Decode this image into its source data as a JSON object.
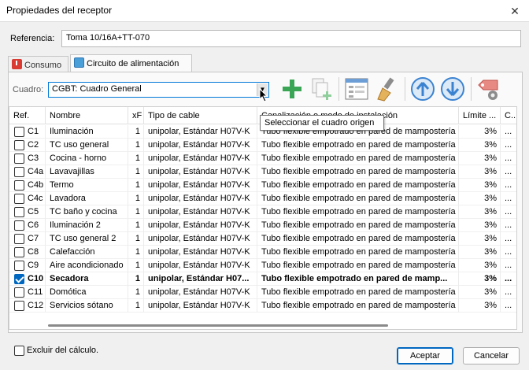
{
  "window": {
    "title": "Propiedades del receptor",
    "close_glyph": "✕"
  },
  "referencia": {
    "label": "Referencia:",
    "value": "Toma 10/16A+TT-070"
  },
  "tabs": [
    {
      "label": "Consumo",
      "icon": "power-icon",
      "active": false
    },
    {
      "label": "Circuito de alimentación",
      "icon": "shield-icon",
      "active": true
    }
  ],
  "cuadro": {
    "label": "Cuadro:",
    "value": "CGBT: Cuadro General"
  },
  "toolbar": {
    "buttons": [
      "add-icon",
      "copy-add-icon",
      "form-icon",
      "brush-icon",
      "arrow-up-icon",
      "arrow-down-icon",
      "tag-settings-icon"
    ]
  },
  "tooltip": {
    "text": "Seleccionar el cuadro origen"
  },
  "table": {
    "headers": {
      "ref": "Ref.",
      "nombre": "Nombre",
      "xf": "xF",
      "tipo": "Tipo de cable",
      "canal": "Canalización o modo de instalación",
      "limite": "Límite ...",
      "last": "C..."
    },
    "rows": [
      {
        "checked": false,
        "ref": "C1",
        "nombre": "Iluminación",
        "xf": "1",
        "tipo": "unipolar, Estándar H07V-K",
        "canal": "Tubo flexible empotrado en pared de mampostería",
        "limite": "3%",
        "last": "..."
      },
      {
        "checked": false,
        "ref": "C2",
        "nombre": "TC uso general",
        "xf": "1",
        "tipo": "unipolar, Estándar H07V-K",
        "canal": "Tubo flexible empotrado en pared de mampostería",
        "limite": "3%",
        "last": "..."
      },
      {
        "checked": false,
        "ref": "C3",
        "nombre": "Cocina - horno",
        "xf": "1",
        "tipo": "unipolar, Estándar H07V-K",
        "canal": "Tubo flexible empotrado en pared de mampostería",
        "limite": "3%",
        "last": "..."
      },
      {
        "checked": false,
        "ref": "C4a",
        "nombre": "Lavavajillas",
        "xf": "1",
        "tipo": "unipolar, Estándar H07V-K",
        "canal": "Tubo flexible empotrado en pared de mampostería",
        "limite": "3%",
        "last": "..."
      },
      {
        "checked": false,
        "ref": "C4b",
        "nombre": "Termo",
        "xf": "1",
        "tipo": "unipolar, Estándar H07V-K",
        "canal": "Tubo flexible empotrado en pared de mampostería",
        "limite": "3%",
        "last": "..."
      },
      {
        "checked": false,
        "ref": "C4c",
        "nombre": "Lavadora",
        "xf": "1",
        "tipo": "unipolar, Estándar H07V-K",
        "canal": "Tubo flexible empotrado en pared de mampostería",
        "limite": "3%",
        "last": "..."
      },
      {
        "checked": false,
        "ref": "C5",
        "nombre": "TC baño y cocina",
        "xf": "1",
        "tipo": "unipolar, Estándar H07V-K",
        "canal": "Tubo flexible empotrado en pared de mampostería",
        "limite": "3%",
        "last": "..."
      },
      {
        "checked": false,
        "ref": "C6",
        "nombre": "Iluminación 2",
        "xf": "1",
        "tipo": "unipolar, Estándar H07V-K",
        "canal": "Tubo flexible empotrado en pared de mampostería",
        "limite": "3%",
        "last": "..."
      },
      {
        "checked": false,
        "ref": "C7",
        "nombre": "TC uso general 2",
        "xf": "1",
        "tipo": "unipolar, Estándar H07V-K",
        "canal": "Tubo flexible empotrado en pared de mampostería",
        "limite": "3%",
        "last": "..."
      },
      {
        "checked": false,
        "ref": "C8",
        "nombre": "Calefacción",
        "xf": "1",
        "tipo": "unipolar, Estándar H07V-K",
        "canal": "Tubo flexible empotrado en pared de mampostería",
        "limite": "3%",
        "last": "..."
      },
      {
        "checked": false,
        "ref": "C9",
        "nombre": "Aire acondicionado",
        "xf": "1",
        "tipo": "unipolar, Estándar H07V-K",
        "canal": "Tubo flexible empotrado en pared de mampostería",
        "limite": "3%",
        "last": "..."
      },
      {
        "checked": true,
        "ref": "C10",
        "nombre": "Secadora",
        "xf": "1",
        "tipo": "unipolar, Estándar H07...",
        "canal": "Tubo flexible empotrado en pared de mamp...",
        "limite": "3%",
        "last": "..."
      },
      {
        "checked": false,
        "ref": "C11",
        "nombre": "Domótica",
        "xf": "1",
        "tipo": "unipolar, Estándar H07V-K",
        "canal": "Tubo flexible empotrado en pared de mampostería",
        "limite": "3%",
        "last": "..."
      },
      {
        "checked": false,
        "ref": "C12",
        "nombre": "Servicios sótano",
        "xf": "1",
        "tipo": "unipolar, Estándar H07V-K",
        "canal": "Tubo flexible empotrado en pared de mampostería",
        "limite": "3%",
        "last": "..."
      }
    ]
  },
  "footer": {
    "exclude_label": "Excluir del cálculo.",
    "exclude_checked": false,
    "accept_label": "Aceptar",
    "cancel_label": "Cancelar"
  },
  "colors": {
    "accent": "#0067c0",
    "green": "#3aa655",
    "blue": "#3b83d1",
    "red": "#d93a32"
  }
}
